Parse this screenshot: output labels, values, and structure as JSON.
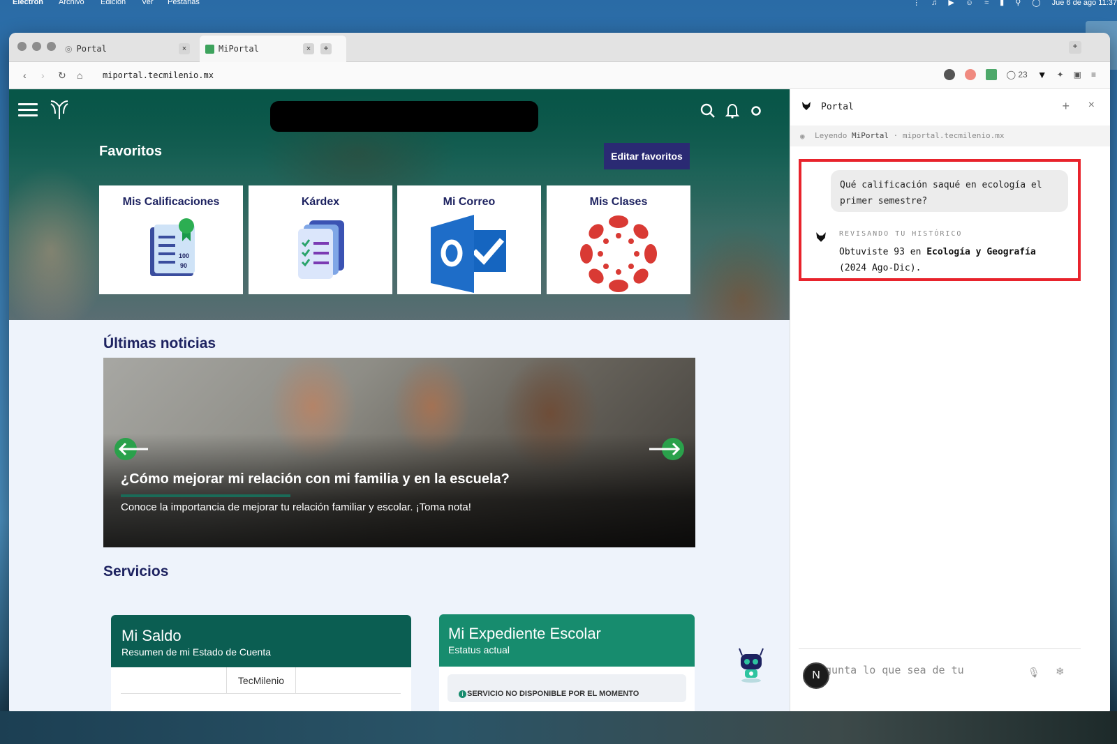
{
  "menubar": {
    "app": "Electron",
    "menus": [
      "Archivo",
      "Edición",
      "Ver",
      "Pestañas"
    ],
    "clock": "Jue 6 de ago  11:37"
  },
  "browser": {
    "tabs": [
      {
        "label": "Portal"
      },
      {
        "label": "MiPortal"
      }
    ],
    "url": "miportal.tecmilenio.mx",
    "ext_badge": "23"
  },
  "portal": {
    "favorites_title": "Favoritos",
    "edit_favorites": "Editar favoritos",
    "cards": [
      {
        "label": "Mis Calificaciones",
        "icon": "grades-icon"
      },
      {
        "label": "Kárdex",
        "icon": "checklist-icon"
      },
      {
        "label": "Mi Correo",
        "icon": "outlook-icon"
      },
      {
        "label": "Mis Clases",
        "icon": "canvas-icon"
      }
    ],
    "grades_icon_numbers": [
      "100",
      "90"
    ],
    "news_title": "Últimas noticias",
    "news_headline": "¿Cómo mejorar mi relación con mi familia y en la escuela?",
    "news_subtitle": "Conoce la importancia de mejorar tu relación familiar y escolar. ¡Toma nota!",
    "services_title": "Servicios",
    "saldo": {
      "title": "Mi Saldo",
      "subtitle": "Resumen de mi Estado de Cuenta",
      "tab": "TecMilenio"
    },
    "expediente": {
      "title": "Mi Expediente Escolar",
      "subtitle": "Estatus actual",
      "message": "SERVICIO NO DISPONIBLE POR EL MOMENTO"
    }
  },
  "sidepanel": {
    "title": "Portal",
    "reading_prefix": "Leyendo",
    "reading_page": "MiPortal",
    "reading_sep": "·",
    "reading_url": "miportal.tecmilenio.mx",
    "user_message": "Qué calificación saqué en ecología el primer semestre?",
    "status_label": "REVISANDO TU HISTÓRICO",
    "answer_prefix": "Obtuviste 93 en",
    "answer_subject": "Ecología y Geografía",
    "answer_suffix": "(2024 Ago-Dic).",
    "composer_placeholder": "gunta lo que sea de tu",
    "avatar_letter": "N"
  }
}
